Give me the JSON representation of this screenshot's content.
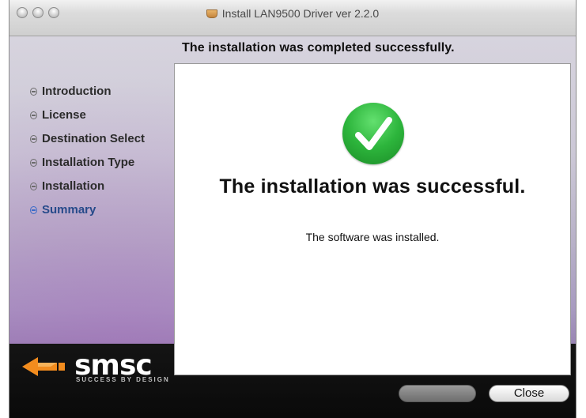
{
  "window": {
    "title": "Install LAN9500 Driver ver 2.2.0",
    "headline": "The installation was completed successfully."
  },
  "sidebar": {
    "items": [
      {
        "label": "Introduction",
        "active": false
      },
      {
        "label": "License",
        "active": false
      },
      {
        "label": "Destination Select",
        "active": false
      },
      {
        "label": "Installation Type",
        "active": false
      },
      {
        "label": "Installation",
        "active": false
      },
      {
        "label": "Summary",
        "active": true
      }
    ]
  },
  "content": {
    "status_icon": "green-checkmark-icon",
    "main_message": "The installation was successful.",
    "sub_message": "The software was installed."
  },
  "branding": {
    "logo_text": "smsc",
    "tagline": "SUCCESS BY DESIGN"
  },
  "buttons": {
    "go_back_label": "",
    "close_label": "Close"
  },
  "colors": {
    "check_green": "#2db53c",
    "active_step": "#3a6bc9",
    "logo_accent": "#f28c1e"
  }
}
